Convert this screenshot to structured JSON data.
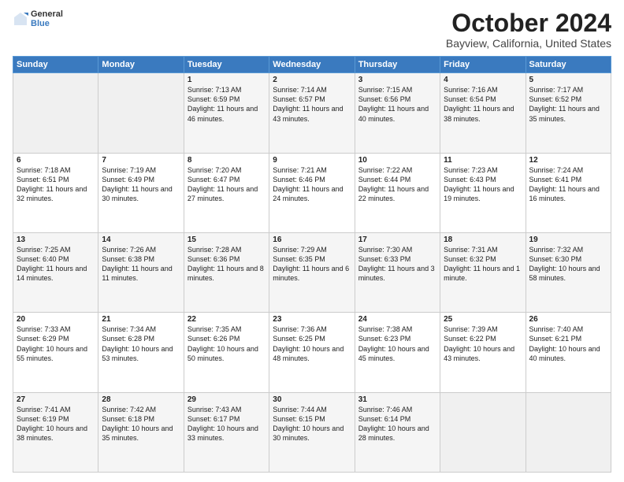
{
  "header": {
    "logo_line1": "General",
    "logo_line2": "Blue",
    "title": "October 2024",
    "subtitle": "Bayview, California, United States"
  },
  "days_of_week": [
    "Sunday",
    "Monday",
    "Tuesday",
    "Wednesday",
    "Thursday",
    "Friday",
    "Saturday"
  ],
  "weeks": [
    [
      {
        "day": "",
        "sunrise": "",
        "sunset": "",
        "daylight": "",
        "empty": true
      },
      {
        "day": "",
        "sunrise": "",
        "sunset": "",
        "daylight": "",
        "empty": true
      },
      {
        "day": "1",
        "sunrise": "Sunrise: 7:13 AM",
        "sunset": "Sunset: 6:59 PM",
        "daylight": "Daylight: 11 hours and 46 minutes.",
        "empty": false
      },
      {
        "day": "2",
        "sunrise": "Sunrise: 7:14 AM",
        "sunset": "Sunset: 6:57 PM",
        "daylight": "Daylight: 11 hours and 43 minutes.",
        "empty": false
      },
      {
        "day": "3",
        "sunrise": "Sunrise: 7:15 AM",
        "sunset": "Sunset: 6:56 PM",
        "daylight": "Daylight: 11 hours and 40 minutes.",
        "empty": false
      },
      {
        "day": "4",
        "sunrise": "Sunrise: 7:16 AM",
        "sunset": "Sunset: 6:54 PM",
        "daylight": "Daylight: 11 hours and 38 minutes.",
        "empty": false
      },
      {
        "day": "5",
        "sunrise": "Sunrise: 7:17 AM",
        "sunset": "Sunset: 6:52 PM",
        "daylight": "Daylight: 11 hours and 35 minutes.",
        "empty": false
      }
    ],
    [
      {
        "day": "6",
        "sunrise": "Sunrise: 7:18 AM",
        "sunset": "Sunset: 6:51 PM",
        "daylight": "Daylight: 11 hours and 32 minutes.",
        "empty": false
      },
      {
        "day": "7",
        "sunrise": "Sunrise: 7:19 AM",
        "sunset": "Sunset: 6:49 PM",
        "daylight": "Daylight: 11 hours and 30 minutes.",
        "empty": false
      },
      {
        "day": "8",
        "sunrise": "Sunrise: 7:20 AM",
        "sunset": "Sunset: 6:47 PM",
        "daylight": "Daylight: 11 hours and 27 minutes.",
        "empty": false
      },
      {
        "day": "9",
        "sunrise": "Sunrise: 7:21 AM",
        "sunset": "Sunset: 6:46 PM",
        "daylight": "Daylight: 11 hours and 24 minutes.",
        "empty": false
      },
      {
        "day": "10",
        "sunrise": "Sunrise: 7:22 AM",
        "sunset": "Sunset: 6:44 PM",
        "daylight": "Daylight: 11 hours and 22 minutes.",
        "empty": false
      },
      {
        "day": "11",
        "sunrise": "Sunrise: 7:23 AM",
        "sunset": "Sunset: 6:43 PM",
        "daylight": "Daylight: 11 hours and 19 minutes.",
        "empty": false
      },
      {
        "day": "12",
        "sunrise": "Sunrise: 7:24 AM",
        "sunset": "Sunset: 6:41 PM",
        "daylight": "Daylight: 11 hours and 16 minutes.",
        "empty": false
      }
    ],
    [
      {
        "day": "13",
        "sunrise": "Sunrise: 7:25 AM",
        "sunset": "Sunset: 6:40 PM",
        "daylight": "Daylight: 11 hours and 14 minutes.",
        "empty": false
      },
      {
        "day": "14",
        "sunrise": "Sunrise: 7:26 AM",
        "sunset": "Sunset: 6:38 PM",
        "daylight": "Daylight: 11 hours and 11 minutes.",
        "empty": false
      },
      {
        "day": "15",
        "sunrise": "Sunrise: 7:28 AM",
        "sunset": "Sunset: 6:36 PM",
        "daylight": "Daylight: 11 hours and 8 minutes.",
        "empty": false
      },
      {
        "day": "16",
        "sunrise": "Sunrise: 7:29 AM",
        "sunset": "Sunset: 6:35 PM",
        "daylight": "Daylight: 11 hours and 6 minutes.",
        "empty": false
      },
      {
        "day": "17",
        "sunrise": "Sunrise: 7:30 AM",
        "sunset": "Sunset: 6:33 PM",
        "daylight": "Daylight: 11 hours and 3 minutes.",
        "empty": false
      },
      {
        "day": "18",
        "sunrise": "Sunrise: 7:31 AM",
        "sunset": "Sunset: 6:32 PM",
        "daylight": "Daylight: 11 hours and 1 minute.",
        "empty": false
      },
      {
        "day": "19",
        "sunrise": "Sunrise: 7:32 AM",
        "sunset": "Sunset: 6:30 PM",
        "daylight": "Daylight: 10 hours and 58 minutes.",
        "empty": false
      }
    ],
    [
      {
        "day": "20",
        "sunrise": "Sunrise: 7:33 AM",
        "sunset": "Sunset: 6:29 PM",
        "daylight": "Daylight: 10 hours and 55 minutes.",
        "empty": false
      },
      {
        "day": "21",
        "sunrise": "Sunrise: 7:34 AM",
        "sunset": "Sunset: 6:28 PM",
        "daylight": "Daylight: 10 hours and 53 minutes.",
        "empty": false
      },
      {
        "day": "22",
        "sunrise": "Sunrise: 7:35 AM",
        "sunset": "Sunset: 6:26 PM",
        "daylight": "Daylight: 10 hours and 50 minutes.",
        "empty": false
      },
      {
        "day": "23",
        "sunrise": "Sunrise: 7:36 AM",
        "sunset": "Sunset: 6:25 PM",
        "daylight": "Daylight: 10 hours and 48 minutes.",
        "empty": false
      },
      {
        "day": "24",
        "sunrise": "Sunrise: 7:38 AM",
        "sunset": "Sunset: 6:23 PM",
        "daylight": "Daylight: 10 hours and 45 minutes.",
        "empty": false
      },
      {
        "day": "25",
        "sunrise": "Sunrise: 7:39 AM",
        "sunset": "Sunset: 6:22 PM",
        "daylight": "Daylight: 10 hours and 43 minutes.",
        "empty": false
      },
      {
        "day": "26",
        "sunrise": "Sunrise: 7:40 AM",
        "sunset": "Sunset: 6:21 PM",
        "daylight": "Daylight: 10 hours and 40 minutes.",
        "empty": false
      }
    ],
    [
      {
        "day": "27",
        "sunrise": "Sunrise: 7:41 AM",
        "sunset": "Sunset: 6:19 PM",
        "daylight": "Daylight: 10 hours and 38 minutes.",
        "empty": false
      },
      {
        "day": "28",
        "sunrise": "Sunrise: 7:42 AM",
        "sunset": "Sunset: 6:18 PM",
        "daylight": "Daylight: 10 hours and 35 minutes.",
        "empty": false
      },
      {
        "day": "29",
        "sunrise": "Sunrise: 7:43 AM",
        "sunset": "Sunset: 6:17 PM",
        "daylight": "Daylight: 10 hours and 33 minutes.",
        "empty": false
      },
      {
        "day": "30",
        "sunrise": "Sunrise: 7:44 AM",
        "sunset": "Sunset: 6:15 PM",
        "daylight": "Daylight: 10 hours and 30 minutes.",
        "empty": false
      },
      {
        "day": "31",
        "sunrise": "Sunrise: 7:46 AM",
        "sunset": "Sunset: 6:14 PM",
        "daylight": "Daylight: 10 hours and 28 minutes.",
        "empty": false
      },
      {
        "day": "",
        "sunrise": "",
        "sunset": "",
        "daylight": "",
        "empty": true
      },
      {
        "day": "",
        "sunrise": "",
        "sunset": "",
        "daylight": "",
        "empty": true
      }
    ]
  ]
}
